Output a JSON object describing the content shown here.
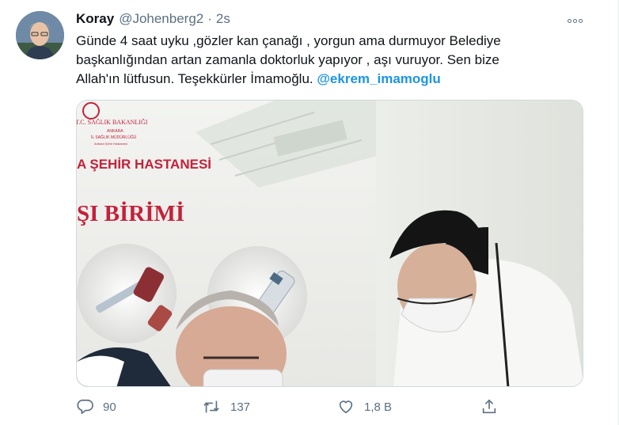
{
  "tweet": {
    "author_name": "Koray",
    "handle": "@Johenberg2",
    "separator": "·",
    "time": "2s",
    "text_line1": "Günde 4 saat uyku ,gözler kan çanağı , yorgun ama durmuyor Belediye",
    "text_line2": "başkanlığından artan zamanla doktorluk yapıyor , aşı vuruyor. Sen bize",
    "text_line3": "Allah'ın lütfusun. Teşekkürler İmamoğlu. ",
    "mention": "@ekrem_imamoglu"
  },
  "media": {
    "banner_ministry": "T.C. SAĞLIK BAKANLIĞI",
    "banner_city": "ANKARA",
    "banner_directorate": "İL SAĞLIK MÜDÜRLÜĞÜ",
    "banner_hospital_small": "Ankara Şehir Hastanesi",
    "banner_hospital": "A ŞEHİR HASTANESİ",
    "banner_unit": "ŞI BİRİMİ"
  },
  "actions": {
    "reply_count": "90",
    "retweet_count": "137",
    "like_count": "1,8 B"
  },
  "colors": {
    "accent": "#1b95e0",
    "secondary_text": "#5b7083",
    "banner_red": "#c4213a"
  },
  "icons": [
    "more-icon",
    "reply-icon",
    "retweet-icon",
    "like-icon",
    "share-icon"
  ]
}
